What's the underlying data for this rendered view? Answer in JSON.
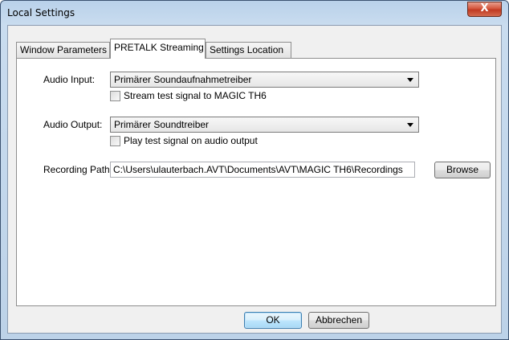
{
  "window": {
    "title": "Local Settings",
    "close_label": "X"
  },
  "tabs": [
    {
      "label": "Window Parameters",
      "active": false
    },
    {
      "label": "PRETALK Streaming",
      "active": true
    },
    {
      "label": "Settings Location",
      "active": false
    }
  ],
  "audio_input": {
    "label": "Audio Input:",
    "selected": "Primärer Soundaufnahmetreiber",
    "checkbox_label": "Stream test signal to MAGIC TH6",
    "checked": false
  },
  "audio_output": {
    "label": "Audio Output:",
    "selected": "Primärer Soundtreiber",
    "checkbox_label": "Play test signal on audio output",
    "checked": false
  },
  "recording": {
    "label": "Recording Path:",
    "value": "C:\\Users\\ulauterbach.AVT\\Documents\\AVT\\MAGIC TH6\\Recordings",
    "browse_label": "Browse"
  },
  "footer": {
    "ok_label": "OK",
    "cancel_label": "Abbrechen"
  }
}
